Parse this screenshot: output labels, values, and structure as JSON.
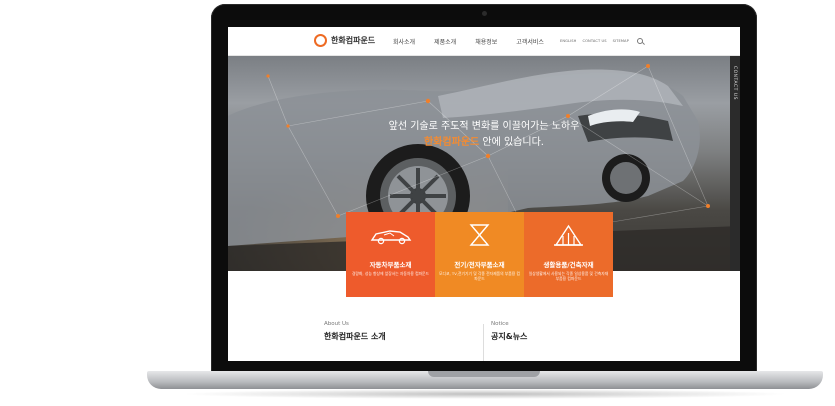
{
  "nav": {
    "logo_text": "한화컴파운드",
    "menu": [
      "회사소개",
      "제품소개",
      "채용정보",
      "고객서비스"
    ],
    "util": [
      "ENGLISH",
      "CONTACT US",
      "SITEMAP"
    ]
  },
  "hero": {
    "headline_line1": "앞선 기술로 주도적 변화를 이끌어가는 노하우",
    "headline_brand": "한화컴파운드",
    "headline_line2_rest": " 안에 있습니다.",
    "contact_tab": "CONTACT US"
  },
  "tiles": [
    {
      "title": "자동차부품소재",
      "desc": "경량화, 성능 향상에 앞장서는 자동차용 컴파운드",
      "color": "#ee5b2c",
      "icon": "car-icon"
    },
    {
      "title": "전기/전자부품소재",
      "desc": "모디코, TV,전기기기 및 각종 전자제품의 부품용 컴파운드",
      "color": "#f08a24",
      "icon": "hourglass-icon"
    },
    {
      "title": "생활용품/건축자재",
      "desc": "일상생활에서 사용되는 각종 일상용품 및 건축자재부품용 컴파운드",
      "color": "#ec6b2a",
      "icon": "building-icon"
    }
  ],
  "sections": [
    {
      "sub": "About Us",
      "title": "한화컴파운드 소개"
    },
    {
      "sub": "Notice",
      "title": "공지&뉴스"
    }
  ]
}
